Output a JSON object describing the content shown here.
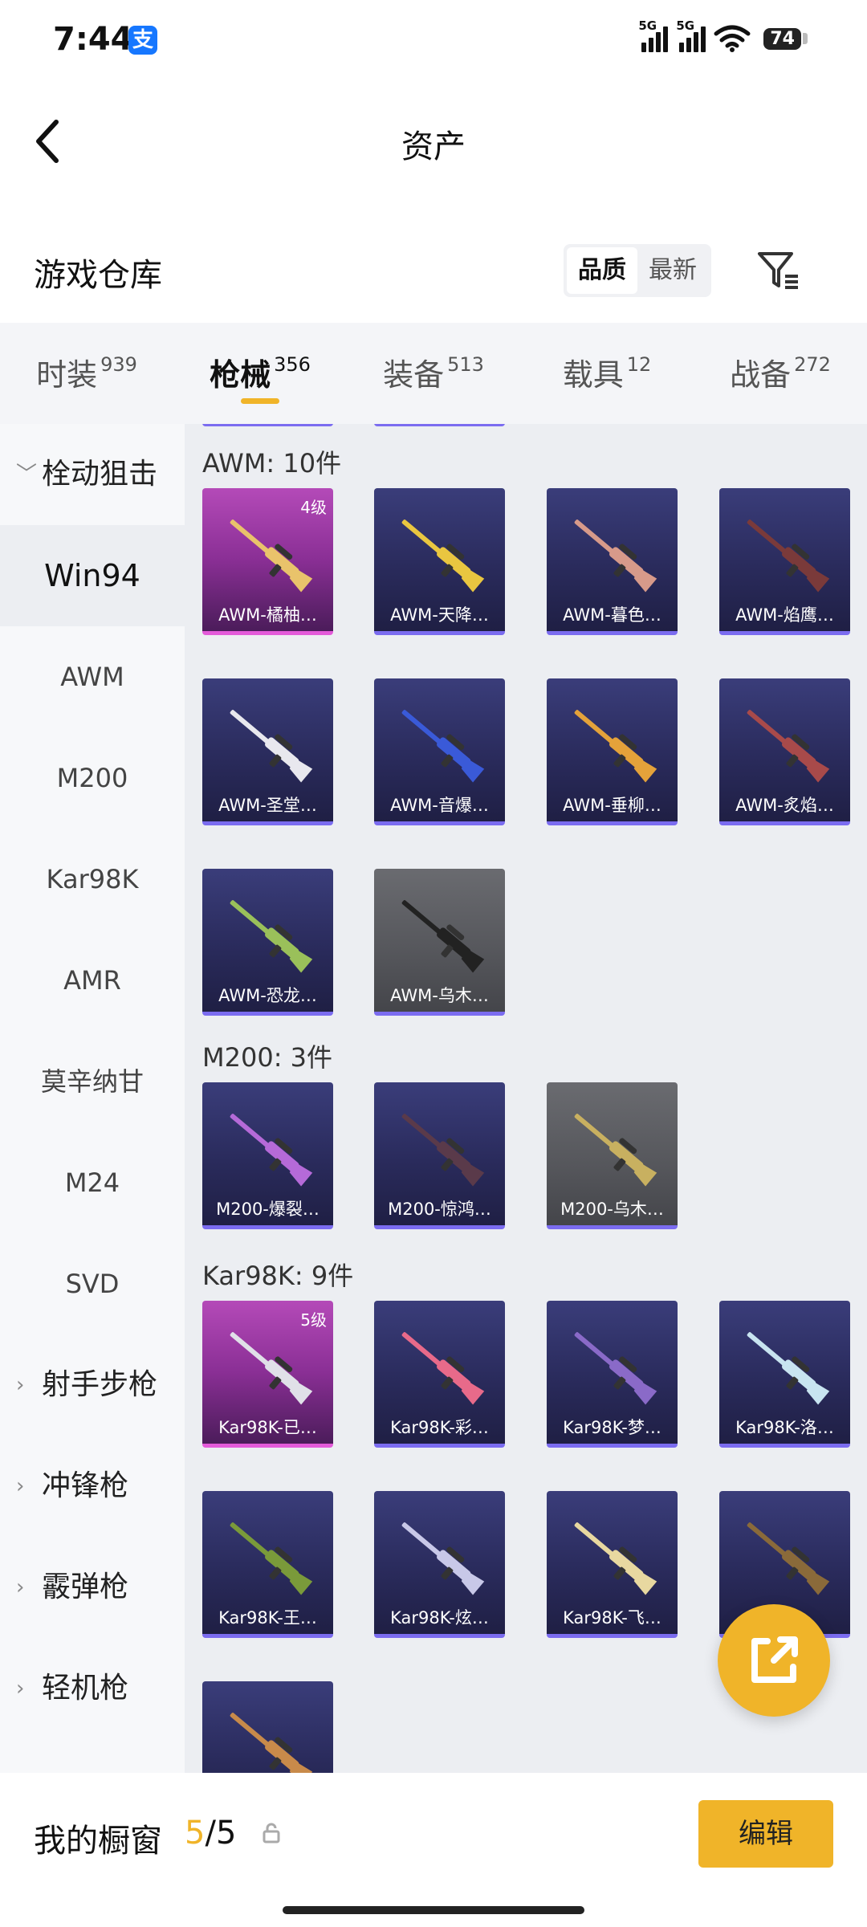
{
  "status": {
    "time": "7:44",
    "pay_icon": "支",
    "signal_1": "5G",
    "signal_2": "5G",
    "battery": "74"
  },
  "header": {
    "title": "资产"
  },
  "warehouse": {
    "label": "游戏仓库",
    "sort_options": [
      "品质",
      "最新"
    ],
    "active_sort": "品质"
  },
  "tabs": [
    {
      "label": "时装",
      "count": "939"
    },
    {
      "label": "枪械",
      "count": "356"
    },
    {
      "label": "装备",
      "count": "513"
    },
    {
      "label": "载具",
      "count": "12"
    },
    {
      "label": "战备",
      "count": "272"
    }
  ],
  "active_tab": "枪械",
  "sidebar": [
    {
      "label": "栓动狙击",
      "type": "group",
      "expanded": true
    },
    {
      "label": "Win94",
      "type": "item",
      "selected": true
    },
    {
      "label": "AWM",
      "type": "item"
    },
    {
      "label": "M200",
      "type": "item"
    },
    {
      "label": "Kar98K",
      "type": "item"
    },
    {
      "label": "AMR",
      "type": "item"
    },
    {
      "label": "莫辛纳甘",
      "type": "item"
    },
    {
      "label": "M24",
      "type": "item"
    },
    {
      "label": "SVD",
      "type": "item"
    },
    {
      "label": "射手步枪",
      "type": "group"
    },
    {
      "label": "冲锋枪",
      "type": "group"
    },
    {
      "label": "霰弹枪",
      "type": "group"
    },
    {
      "label": "轻机枪",
      "type": "group"
    }
  ],
  "sections": [
    {
      "title": "AWM: 10件",
      "items": [
        {
          "name": "AWM-橘柚…",
          "level": "4级",
          "tier": "pink",
          "color": "#e9c36b"
        },
        {
          "name": "AWM-天降…",
          "tier": "purple",
          "color": "#e9c640"
        },
        {
          "name": "AWM-暮色…",
          "tier": "purple",
          "color": "#d79a8a"
        },
        {
          "name": "AWM-焰鹰…",
          "tier": "purple",
          "color": "#7a3a3a"
        },
        {
          "name": "AWM-圣堂…",
          "tier": "purple",
          "color": "#e8e8ee"
        },
        {
          "name": "AWM-音爆…",
          "tier": "purple",
          "color": "#3a5ad8"
        },
        {
          "name": "AWM-垂柳…",
          "tier": "purple",
          "color": "#e4a23a"
        },
        {
          "name": "AWM-炙焰…",
          "tier": "purple",
          "color": "#a84a4a"
        },
        {
          "name": "AWM-恐龙…",
          "tier": "purple",
          "color": "#9ac05a"
        },
        {
          "name": "AWM-乌木…",
          "tier": "grey",
          "color": "#222222"
        }
      ]
    },
    {
      "title": "M200: 3件",
      "items": [
        {
          "name": "M200-爆裂…",
          "tier": "purple",
          "color": "#b56ad8"
        },
        {
          "name": "M200-惊鸿…",
          "tier": "purple",
          "color": "#5a3a4a"
        },
        {
          "name": "M200-乌木…",
          "tier": "grey",
          "color": "#c8b060"
        }
      ]
    },
    {
      "title": "Kar98K: 9件",
      "items": [
        {
          "name": "Kar98K-已…",
          "level": "5级",
          "tier": "pink",
          "color": "#e0e0e8"
        },
        {
          "name": "Kar98K-彩…",
          "tier": "purple",
          "color": "#e86a8a"
        },
        {
          "name": "Kar98K-梦…",
          "tier": "purple",
          "color": "#8a6ac8"
        },
        {
          "name": "Kar98K-洛…",
          "tier": "purple",
          "color": "#c8e4f0"
        },
        {
          "name": "Kar98K-王…",
          "tier": "purple",
          "color": "#7a9a3a"
        },
        {
          "name": "Kar98K-炫…",
          "tier": "purple",
          "color": "#c8c8e8"
        },
        {
          "name": "Kar98K-飞…",
          "tier": "purple",
          "color": "#e8d8a0"
        },
        {
          "name": "",
          "tier": "purple",
          "color": "#8a6a3a"
        },
        {
          "name": "",
          "tier": "purple",
          "color": "#c88a4a"
        }
      ]
    }
  ],
  "bottom": {
    "label": "我的橱窗",
    "count_current": "5",
    "count_sep": "/",
    "count_total": "5",
    "edit_label": "编辑"
  },
  "colors": {
    "accent": "#f0b429",
    "pink_card": "#b44ab8",
    "purple_card": "#2a2b5c",
    "grey_card": "#55565b"
  },
  "icons": {
    "back": "chevron-left-icon",
    "filter": "filter-icon",
    "lock": "lock-icon",
    "share": "share-external-icon"
  }
}
